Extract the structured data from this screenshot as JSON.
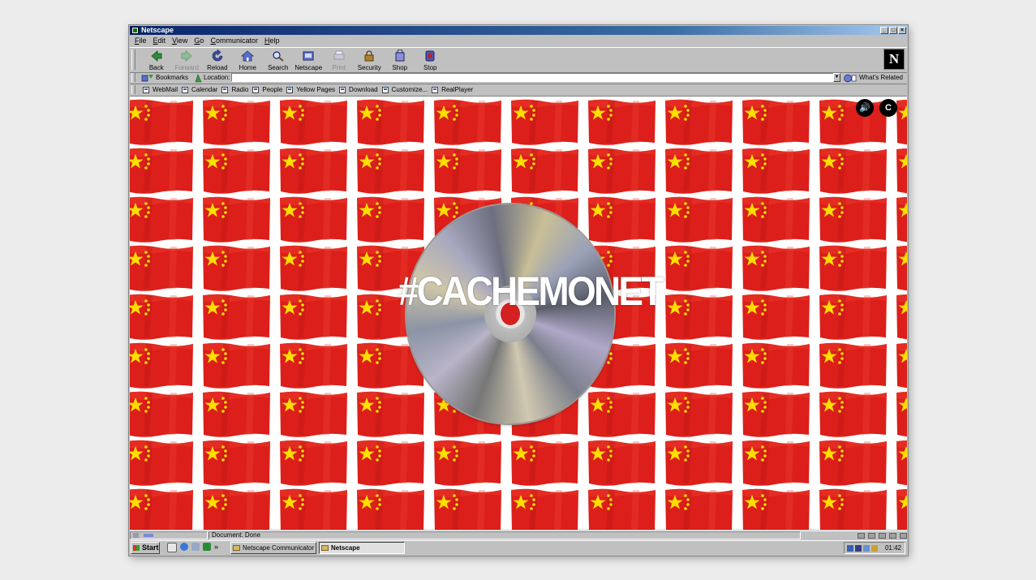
{
  "window": {
    "title": "Netscape",
    "controls": [
      "_",
      "□",
      "×"
    ]
  },
  "menu": [
    "File",
    "Edit",
    "View",
    "Go",
    "Communicator",
    "Help"
  ],
  "toolbar": {
    "buttons": [
      {
        "label": "Back",
        "icon": "back-arrow-icon",
        "enabled": true
      },
      {
        "label": "Forward",
        "icon": "forward-arrow-icon",
        "enabled": false
      },
      {
        "label": "Reload",
        "icon": "reload-icon",
        "enabled": true
      },
      {
        "label": "Home",
        "icon": "home-icon",
        "enabled": true
      },
      {
        "label": "Search",
        "icon": "search-icon",
        "enabled": true
      },
      {
        "label": "Netscape",
        "icon": "netscape-icon",
        "enabled": true
      },
      {
        "label": "Print",
        "icon": "printer-icon",
        "enabled": false
      },
      {
        "label": "Security",
        "icon": "lock-icon",
        "enabled": true
      },
      {
        "label": "Shop",
        "icon": "shop-icon",
        "enabled": true
      },
      {
        "label": "Stop",
        "icon": "stop-icon",
        "enabled": true
      }
    ],
    "logo": "N"
  },
  "location": {
    "bookmarks_label": "Bookmarks",
    "location_label": "Location:",
    "value": "",
    "whats_related": "What's Related"
  },
  "personal_toolbar": [
    "WebMail",
    "Calendar",
    "Radio",
    "People",
    "Yellow Pages",
    "Download",
    "Customize...",
    "RealPlayer"
  ],
  "content": {
    "headline": "#CACHEMONET",
    "sound_icon": "🔊",
    "badge_letter": "C",
    "flag_red": "#dc1f1a",
    "star_yellow": "#ffde00"
  },
  "status": {
    "text": "Document: Done"
  },
  "taskbar": {
    "start": "Start",
    "quicklaunch_more": "»",
    "tasks": [
      "Netscape Communicator",
      "Netscape"
    ],
    "clock": "01:42"
  }
}
